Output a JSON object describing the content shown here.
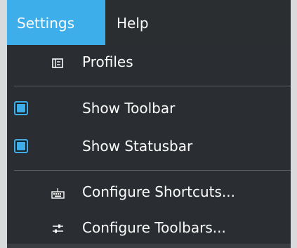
{
  "menubar": {
    "items": [
      {
        "label": "Settings"
      },
      {
        "label": "Help"
      }
    ]
  },
  "menu": {
    "profiles": {
      "label": "Profiles",
      "icon": "profiles-icon"
    },
    "show_toolbar": {
      "label": "Show Toolbar",
      "checked": true
    },
    "show_statusbar": {
      "label": "Show Statusbar",
      "checked": true
    },
    "configure_shortcuts": {
      "label": "Configure Shortcuts...",
      "icon": "keyboard-icon"
    },
    "configure_toolbars": {
      "label": "Configure Toolbars...",
      "icon": "sliders-icon"
    }
  },
  "colors": {
    "accent": "#3daee9",
    "menu_background": "#2a2e32",
    "text": "#fcfcfc"
  }
}
